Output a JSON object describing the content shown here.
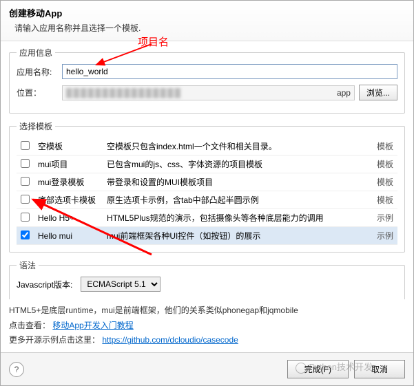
{
  "header": {
    "title": "创建移动App",
    "subtitle": "请输入应用名称并且选择一个模板.",
    "annotation": "项目名"
  },
  "appInfo": {
    "legend": "应用信息",
    "nameLabel": "应用名称:",
    "nameValue": "hello_world",
    "locLabel": "位置：",
    "locSuffix": "app",
    "browse": "浏览..."
  },
  "templates": {
    "legend": "选择模板",
    "typeTemplate": "模板",
    "typeExample": "示例",
    "rows": [
      {
        "name": "空模板",
        "desc": "空模板只包含index.html一个文件和相关目录。",
        "type": "模板",
        "checked": false
      },
      {
        "name": "mui项目",
        "desc": "已包含mui的js、css、字体资源的项目模板",
        "type": "模板",
        "checked": false
      },
      {
        "name": "mui登录模板",
        "desc": "带登录和设置的MUI模板项目",
        "type": "模板",
        "checked": false
      },
      {
        "name": "底部选项卡模板",
        "desc": "原生选项卡示例，含tab中部凸起半圆示例",
        "type": "模板",
        "checked": false
      },
      {
        "name": "Hello H5+",
        "desc": "HTML5Plus规范的演示，包括摄像头等各种底层能力的调用",
        "type": "示例",
        "checked": false
      },
      {
        "name": "Hello mui",
        "desc": "mui前端框架各种UI控件（如按钮）的展示",
        "type": "示例",
        "checked": true
      }
    ]
  },
  "syntax": {
    "legend": "语法",
    "jsLabel": "Javascript版本:",
    "jsValue": "ECMAScript 5.1"
  },
  "info": {
    "line1a": "HTML5+是底层runtime，mui是前端框架，他们的关系类似phonegap和jqmobile",
    "line2a": "点击查看：",
    "link1": "移动App开发入门教程",
    "line3a": "更多开源示例点击这里：",
    "link2": "https://github.com/dcloudio/casecode"
  },
  "footer": {
    "help": "?",
    "finish": "完成(F)",
    "cancel": "取消"
  },
  "watermark": "Python技术开发"
}
